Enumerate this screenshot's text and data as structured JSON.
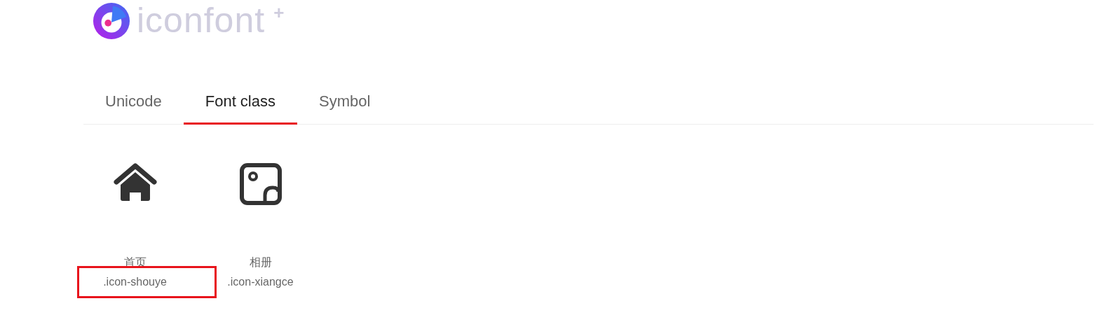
{
  "logo": {
    "text": "iconfont",
    "mark": "+"
  },
  "tabs": [
    {
      "label": "Unicode",
      "selected": false
    },
    {
      "label": "Font class",
      "selected": true
    },
    {
      "label": "Symbol",
      "selected": false
    }
  ],
  "icons": [
    {
      "kind": "house",
      "name": "首页",
      "class_name": ".icon-shouye",
      "highlighted": true
    },
    {
      "kind": "photo",
      "name": "相册",
      "class_name": ".icon-xiangce",
      "highlighted": false
    }
  ]
}
